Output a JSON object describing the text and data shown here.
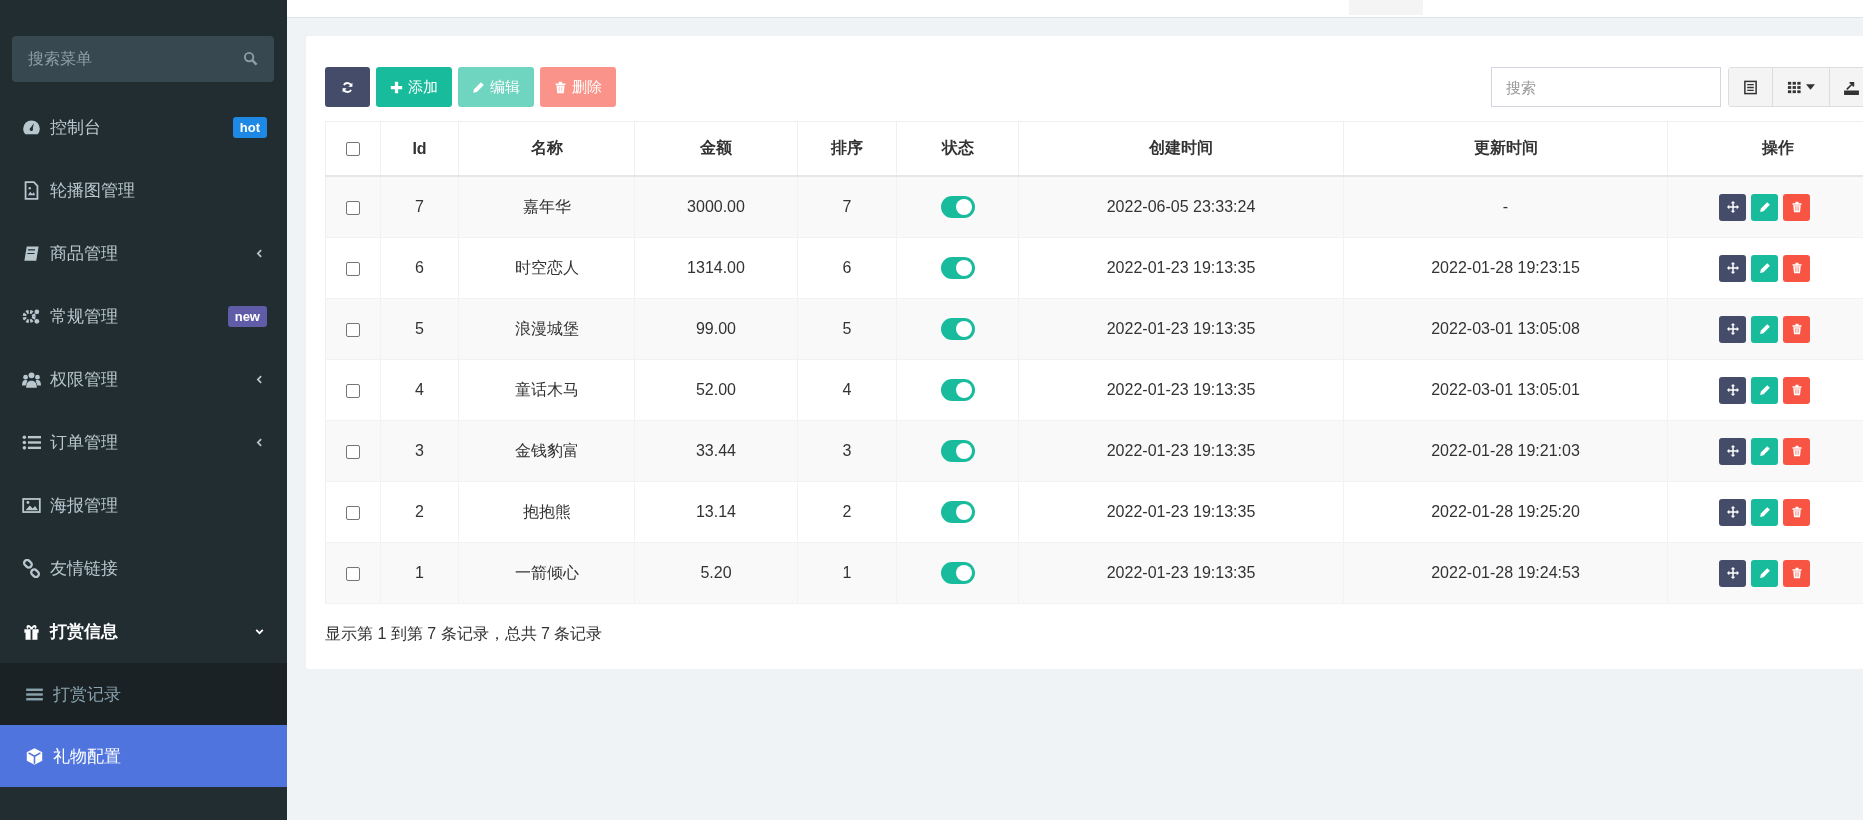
{
  "sidebar": {
    "search": {
      "placeholder": "搜索菜单"
    },
    "items": [
      {
        "label": "控制台",
        "kind": "link",
        "selected": false,
        "badge": {
          "text": "hot",
          "color": "#1e88e5"
        }
      },
      {
        "label": "轮播图管理",
        "kind": "link",
        "selected": false
      },
      {
        "label": "商品管理",
        "kind": "group",
        "selected": false,
        "expanded": false
      },
      {
        "label": "常规管理",
        "kind": "link",
        "selected": false,
        "badge": {
          "text": "new",
          "color": "#605ca8"
        }
      },
      {
        "label": "权限管理",
        "kind": "group",
        "selected": false,
        "expanded": false
      },
      {
        "label": "订单管理",
        "kind": "group",
        "selected": false,
        "expanded": false
      },
      {
        "label": "海报管理",
        "kind": "link",
        "selected": false
      },
      {
        "label": "友情链接",
        "kind": "link",
        "selected": false
      },
      {
        "label": "打赏信息",
        "kind": "group",
        "selected": false,
        "expanded": true,
        "children": [
          {
            "label": "打赏记录",
            "selected": false
          },
          {
            "label": "礼物配置",
            "selected": true
          }
        ]
      }
    ]
  },
  "toolbar": {
    "buttons": [
      {
        "kind": "refresh",
        "disabled": false
      },
      {
        "kind": "add",
        "label": "添加",
        "disabled": false
      },
      {
        "kind": "edit",
        "label": "编辑",
        "disabled": true
      },
      {
        "kind": "delete",
        "label": "删除",
        "disabled": true
      }
    ],
    "search": {
      "placeholder": "搜索"
    }
  },
  "table": {
    "select_all": {
      "checked": false
    },
    "columns": [
      "Id",
      "名称",
      "金额",
      "排序",
      "状态",
      "创建时间",
      "更新时间",
      "操作"
    ],
    "rows": [
      {
        "checked": false,
        "id": "7",
        "name": "嘉年华",
        "amount": "3000.00",
        "sort": "7",
        "enabled": true,
        "created": "2022-06-05 23:33:24",
        "updated": "-"
      },
      {
        "checked": false,
        "id": "6",
        "name": "时空恋人",
        "amount": "1314.00",
        "sort": "6",
        "enabled": true,
        "created": "2022-01-23 19:13:35",
        "updated": "2022-01-28 19:23:15"
      },
      {
        "checked": false,
        "id": "5",
        "name": "浪漫城堡",
        "amount": "99.00",
        "sort": "5",
        "enabled": true,
        "created": "2022-01-23 19:13:35",
        "updated": "2022-03-01 13:05:08"
      },
      {
        "checked": false,
        "id": "4",
        "name": "童话木马",
        "amount": "52.00",
        "sort": "4",
        "enabled": true,
        "created": "2022-01-23 19:13:35",
        "updated": "2022-03-01 13:05:01"
      },
      {
        "checked": false,
        "id": "3",
        "name": "金钱豹富",
        "amount": "33.44",
        "sort": "3",
        "enabled": true,
        "created": "2022-01-23 19:13:35",
        "updated": "2022-01-28 19:21:03"
      },
      {
        "checked": false,
        "id": "2",
        "name": "抱抱熊",
        "amount": "13.14",
        "sort": "2",
        "enabled": true,
        "created": "2022-01-23 19:13:35",
        "updated": "2022-01-28 19:25:20"
      },
      {
        "checked": false,
        "id": "1",
        "name": "一箭倾心",
        "amount": "5.20",
        "sort": "1",
        "enabled": true,
        "created": "2022-01-23 19:13:35",
        "updated": "2022-01-28 19:24:53"
      }
    ]
  },
  "summary": "显示第 1 到第 7 条记录，总共 7 条记录"
}
